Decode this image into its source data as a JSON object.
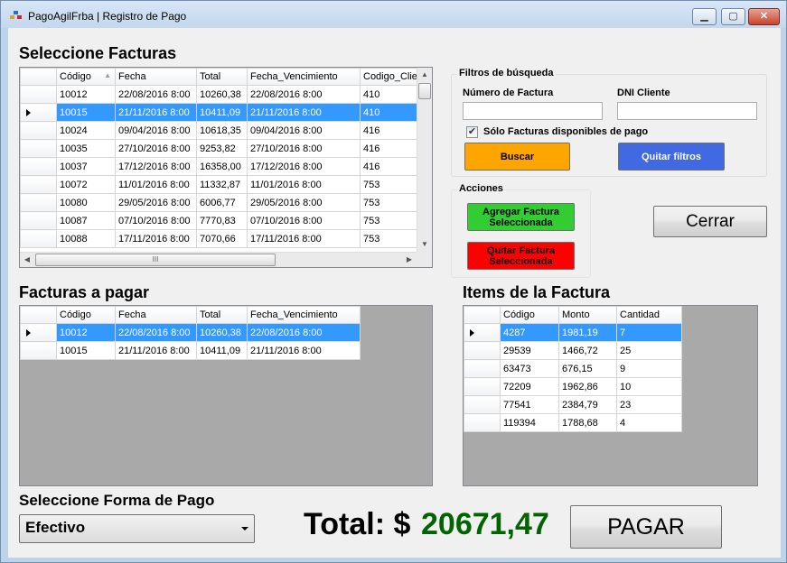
{
  "window": {
    "title": "PagoAgilFrba | Registro de Pago",
    "minimize": "▁",
    "maximize": "▢",
    "close": "✕"
  },
  "seleccione_facturas": {
    "heading": "Seleccione Facturas",
    "columns": [
      "Código",
      "Fecha",
      "Total",
      "Fecha_Vencimiento",
      "Codigo_Clie"
    ],
    "sort_indicator": "▲",
    "rows": [
      [
        "10012",
        "22/08/2016 8:00",
        "10260,38",
        "22/08/2016 8:00",
        "410"
      ],
      [
        "10015",
        "21/11/2016 8:00",
        "10411,09",
        "21/11/2016 8:00",
        "410"
      ],
      [
        "10024",
        "09/04/2016 8:00",
        "10618,35",
        "09/04/2016 8:00",
        "416"
      ],
      [
        "10035",
        "27/10/2016 8:00",
        "9253,82",
        "27/10/2016 8:00",
        "416"
      ],
      [
        "10037",
        "17/12/2016 8:00",
        "16358,00",
        "17/12/2016 8:00",
        "416"
      ],
      [
        "10072",
        "11/01/2016 8:00",
        "11332,87",
        "11/01/2016 8:00",
        "753"
      ],
      [
        "10080",
        "29/05/2016 8:00",
        "6006,77",
        "29/05/2016 8:00",
        "753"
      ],
      [
        "10087",
        "07/10/2016 8:00",
        "7770,83",
        "07/10/2016 8:00",
        "753"
      ],
      [
        "10088",
        "17/11/2016 8:00",
        "7070,66",
        "17/11/2016 8:00",
        "753"
      ]
    ],
    "selected_row": 1,
    "hscroll_grip": "III"
  },
  "filtros": {
    "title": "Filtros de búsqueda",
    "numero_factura_label": "Número de Factura",
    "numero_factura_value": "",
    "dni_cliente_label": "DNI Cliente",
    "dni_cliente_value": "",
    "solo_disponibles_label": "Sólo Facturas disponibles de pago",
    "solo_disponibles_checked": true,
    "check_mark": "✔",
    "buscar_label": "Buscar",
    "quitar_filtros_label": "Quitar filtros"
  },
  "acciones": {
    "title": "Acciones",
    "agregar_label": "Agregar Factura Seleccionada",
    "quitar_label": "Quitar Factura Seleccionada"
  },
  "cerrar_label": "Cerrar",
  "facturas_a_pagar": {
    "heading": "Facturas a pagar",
    "columns": [
      "Código",
      "Fecha",
      "Total",
      "Fecha_Vencimiento"
    ],
    "rows": [
      [
        "10012",
        "22/08/2016 8:00",
        "10260,38",
        "22/08/2016 8:00"
      ],
      [
        "10015",
        "21/11/2016 8:00",
        "10411,09",
        "21/11/2016 8:00"
      ]
    ],
    "selected_row": 0
  },
  "items_factura": {
    "heading": "Items de la Factura",
    "columns": [
      "Código",
      "Monto",
      "Cantidad"
    ],
    "rows": [
      [
        "4287",
        "1981,19",
        "7"
      ],
      [
        "29539",
        "1466,72",
        "25"
      ],
      [
        "63473",
        "676,15",
        "9"
      ],
      [
        "72209",
        "1962,86",
        "10"
      ],
      [
        "77541",
        "2384,79",
        "23"
      ],
      [
        "119394",
        "1788,68",
        "4"
      ]
    ],
    "selected_row": 0
  },
  "forma_pago": {
    "heading": "Seleccione Forma de Pago",
    "selected": "Efectivo"
  },
  "total": {
    "label": "Total: $",
    "value": "20671,47"
  },
  "pagar_label": "PAGAR",
  "colors": {
    "buscar_bg": "#ffa500",
    "quitar_filtros_bg": "#4169e1",
    "agregar_bg": "#32cd32",
    "quitar_factura_bg": "#ff0000",
    "total_value": "#006400",
    "selection": "#3399ff"
  }
}
